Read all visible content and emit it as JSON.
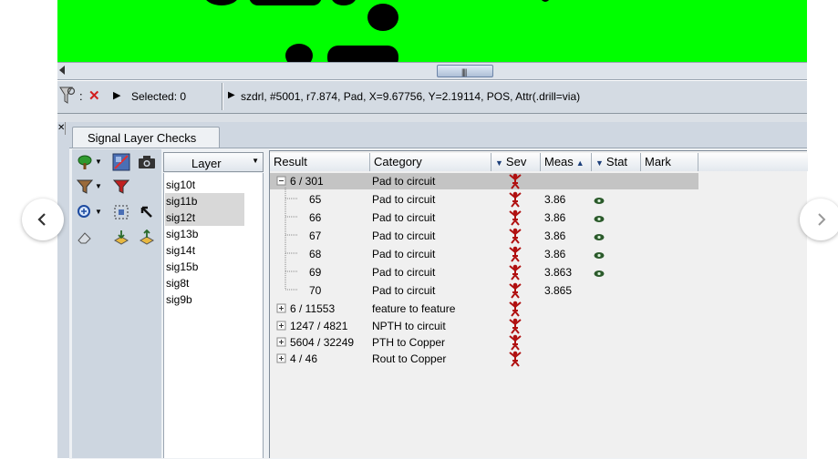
{
  "top_bar": {
    "selection_status": "Selected: 0",
    "feature_info": "szdrl, #5001, r7.874, Pad, X=9.67756, Y=2.19114, POS, Attr(.drill=via)"
  },
  "panel": {
    "tab_label": "Signal Layer Checks",
    "layer_header": "Layer",
    "layers": [
      {
        "name": "sig10t",
        "selected": false
      },
      {
        "name": "sig11b",
        "selected": true
      },
      {
        "name": "sig12t",
        "selected": true
      },
      {
        "name": "sig13b",
        "selected": false
      },
      {
        "name": "sig14t",
        "selected": false
      },
      {
        "name": "sig15b",
        "selected": false
      },
      {
        "name": "sig8t",
        "selected": false
      },
      {
        "name": "sig9b",
        "selected": false
      }
    ]
  },
  "results": {
    "columns": [
      "Result",
      "Category",
      "Sev",
      "Meas",
      "Stat",
      "Mark"
    ],
    "rows": [
      {
        "result": "6 / 301",
        "category": "Pad to circuit",
        "meas": "",
        "stat": false
      },
      {
        "result": "65",
        "category": "Pad to circuit",
        "meas": "3.86",
        "stat": true
      },
      {
        "result": "66",
        "category": "Pad to circuit",
        "meas": "3.86",
        "stat": true
      },
      {
        "result": "67",
        "category": "Pad to circuit",
        "meas": "3.86",
        "stat": true
      },
      {
        "result": "68",
        "category": "Pad to circuit",
        "meas": "3.86",
        "stat": true
      },
      {
        "result": "69",
        "category": "Pad to circuit",
        "meas": "3.863",
        "stat": true
      },
      {
        "result": "70",
        "category": "Pad to circuit",
        "meas": "3.865",
        "stat": false
      },
      {
        "result": "6 / 11553",
        "category": "feature to feature",
        "meas": "",
        "stat": false
      },
      {
        "result": "1247 / 4821",
        "category": "NPTH to circuit",
        "meas": "",
        "stat": false
      },
      {
        "result": "5604 / 32249",
        "category": "PTH to Copper",
        "meas": "",
        "stat": false
      },
      {
        "result": "4 / 46",
        "category": "Rout to Copper",
        "meas": "",
        "stat": false
      }
    ]
  },
  "colors": {
    "canvas_green": "#00ff00",
    "severity_red": "#b01010",
    "clear_x_red": "#d21e1e"
  },
  "icons": [
    "filter-icon",
    "clear-icon",
    "play-icon",
    "tree-icon",
    "layer-view-icon",
    "camera-icon",
    "pointer-icon",
    "severity-icon",
    "eye-icon"
  ]
}
